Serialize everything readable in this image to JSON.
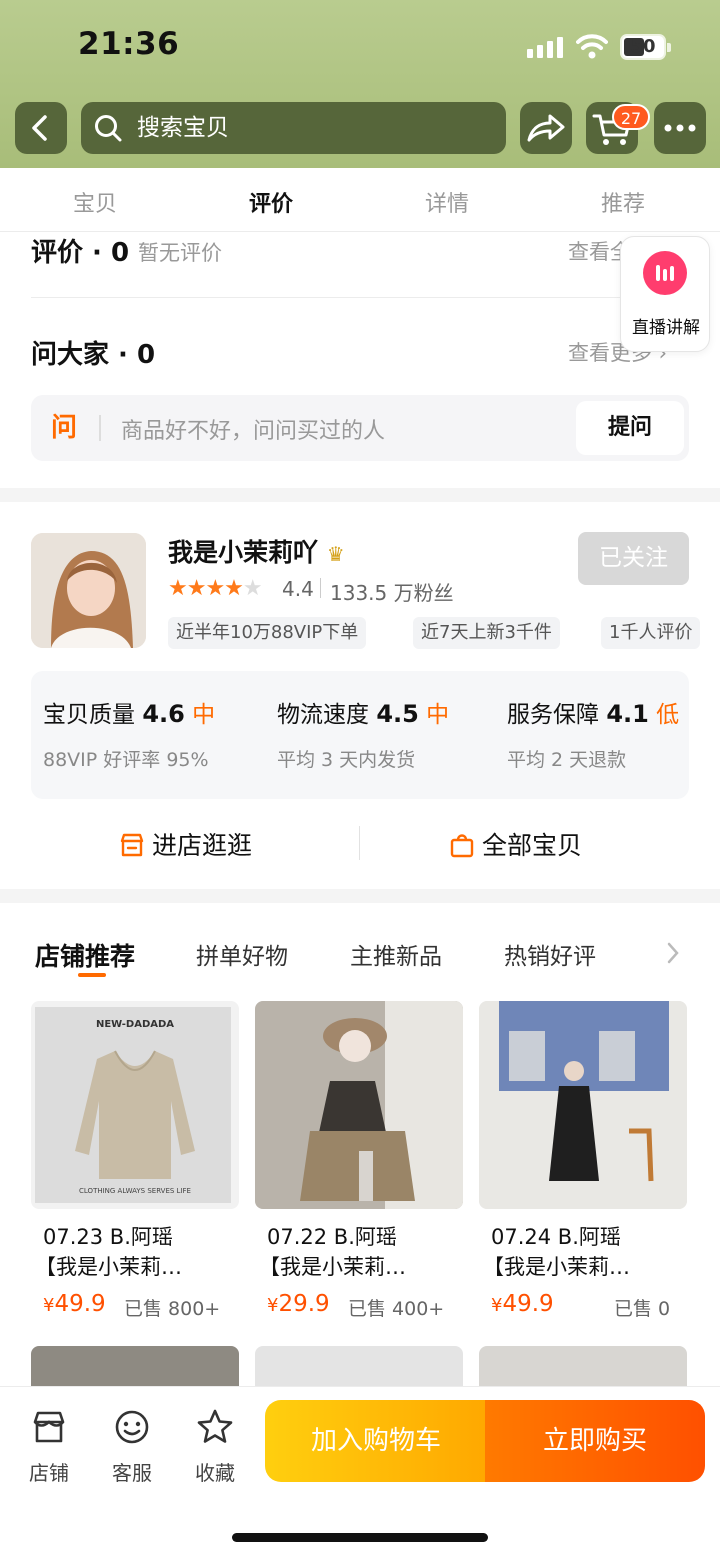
{
  "status_bar": {
    "time": "21:36",
    "battery": "50"
  },
  "header": {
    "search_placeholder": "搜索宝贝",
    "cart_count": "27",
    "icons": [
      "back-icon",
      "search-icon",
      "share-icon",
      "cart-icon",
      "more-icon"
    ]
  },
  "tabs": [
    {
      "label": "宝贝",
      "active": false
    },
    {
      "label": "评价",
      "active": true
    },
    {
      "label": "详情",
      "active": false
    },
    {
      "label": "推荐",
      "active": false
    }
  ],
  "reviews": {
    "title": "评价 · 0",
    "empty_text": "暂无评价",
    "view_all": "查看全部 ›"
  },
  "qa": {
    "title": "问大家 · 0",
    "view_more": "查看更多 ›",
    "ask_icon_text": "问",
    "ask_placeholder": "商品好不好，问问买过的人",
    "ask_button": "提问"
  },
  "live_float": {
    "label": "直播讲解"
  },
  "shop": {
    "name": "我是小茉莉吖",
    "crown": "♛",
    "follow_button": "已关注",
    "rating": 4.4,
    "rating_text": "4.4",
    "fans": "133.5 万粉丝",
    "tags": [
      "近半年10万88VIP下单",
      "近7天上新3千件",
      "1千人评价"
    ],
    "metrics": [
      {
        "label": "宝贝质量",
        "score": "4.6",
        "level": "中",
        "sub": "88VIP 好评率 95%"
      },
      {
        "label": "物流速度",
        "score": "4.5",
        "level": "中",
        "sub": "平均 3 天内发货"
      },
      {
        "label": "服务保障",
        "score": "4.1",
        "level": "低",
        "sub": "平均 2 天退款"
      }
    ],
    "actions": [
      {
        "label": "进店逛逛",
        "icon": "store-icon"
      },
      {
        "label": "全部宝贝",
        "icon": "bag-icon"
      }
    ]
  },
  "recommend": {
    "tabs": [
      "店铺推荐",
      "拼单好物",
      "主推新品",
      "热销好评"
    ],
    "products": [
      {
        "title1": "07.23 B.阿瑶",
        "title2": "【我是小茉莉…",
        "price": "49.9",
        "sold": "已售 800+",
        "image_text": "NEW-DADADA",
        "image_caption": "CLOTHING ALWAYS SERVES LIFE"
      },
      {
        "title1": "07.22 B.阿瑶",
        "title2": "【我是小茉莉…",
        "price": "29.9",
        "sold": "已售 400+"
      },
      {
        "title1": "07.24 B.阿瑶",
        "title2": "【我是小茉莉…",
        "price": "49.9",
        "sold": "已售 0"
      }
    ]
  },
  "bottom_bar": {
    "items": [
      {
        "label": "店铺",
        "icon": "store-icon"
      },
      {
        "label": "客服",
        "icon": "service-icon"
      },
      {
        "label": "收藏",
        "icon": "star-icon"
      }
    ],
    "add_to_cart": "加入购物车",
    "buy_now": "立即购买"
  }
}
